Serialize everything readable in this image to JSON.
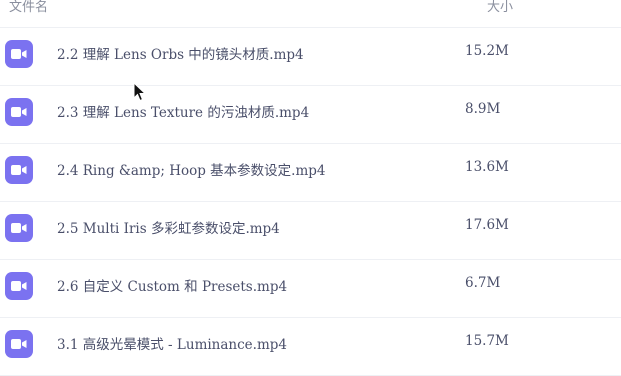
{
  "header": {
    "name_label": "文件名",
    "size_label": "大小"
  },
  "files": [
    {
      "name": "2.2 理解 Lens Orbs 中的镜头材质.mp4",
      "size": "15.2M",
      "icon": "video-file-icon"
    },
    {
      "name": "2.3 理解 Lens Texture 的污浊材质.mp4",
      "size": "8.9M",
      "icon": "video-file-icon"
    },
    {
      "name": "2.4 Ring &amp; Hoop 基本参数设定.mp4",
      "size": "13.6M",
      "icon": "video-file-icon"
    },
    {
      "name": "2.5 Multi Iris 多彩虹参数设定.mp4",
      "size": "17.6M",
      "icon": "video-file-icon"
    },
    {
      "name": "2.6 自定义 Custom 和 Presets.mp4",
      "size": "6.7M",
      "icon": "video-file-icon"
    },
    {
      "name": "3.1 高级光晕模式 - Luminance.mp4",
      "size": "15.7M",
      "icon": "video-file-icon"
    }
  ],
  "colors": {
    "icon_bg": "#7b72f0",
    "text": "#4a4f6a",
    "header_text": "#8a8f9e",
    "divider": "#eef0f4"
  }
}
